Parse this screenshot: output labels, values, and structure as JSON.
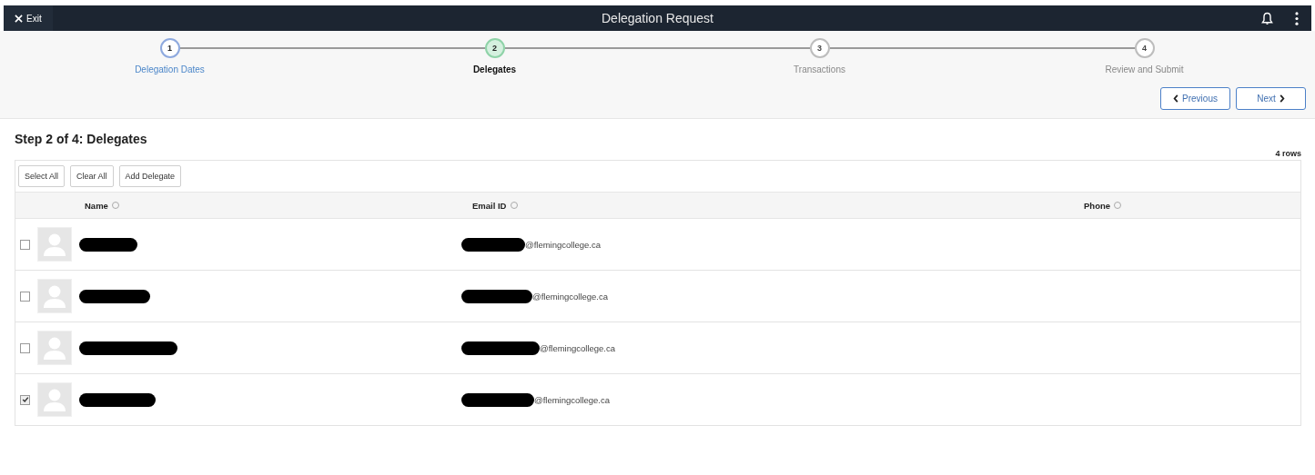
{
  "header": {
    "exit_label": "Exit",
    "title": "Delegation Request"
  },
  "steps": [
    {
      "number": "1",
      "label": "Delegation Dates",
      "selected": false,
      "visited": true
    },
    {
      "number": "2",
      "label": "Delegates",
      "selected": true,
      "visited": false
    },
    {
      "number": "3",
      "label": "Transactions",
      "selected": false,
      "visited": false
    },
    {
      "number": "4",
      "label": "Review and Submit",
      "selected": false,
      "visited": false
    }
  ],
  "nav_buttons": {
    "previous": "Previous",
    "next": "Next"
  },
  "page_title": "Step 2 of 4: Delegates",
  "row_count": "4 rows",
  "toolbar": [
    "Select All",
    "Clear All",
    "Add Delegate"
  ],
  "table": {
    "columns": [
      "Name",
      "Email ID",
      "Phone"
    ],
    "rows": [
      {
        "email": "@flemingcollege.ca",
        "checked": false
      },
      {
        "email": "@flemingcollege.ca",
        "checked": false
      },
      {
        "email": "@flemingcollege.ca",
        "checked": false
      },
      {
        "email": "@flemingcollege.ca",
        "checked": true
      }
    ]
  }
}
